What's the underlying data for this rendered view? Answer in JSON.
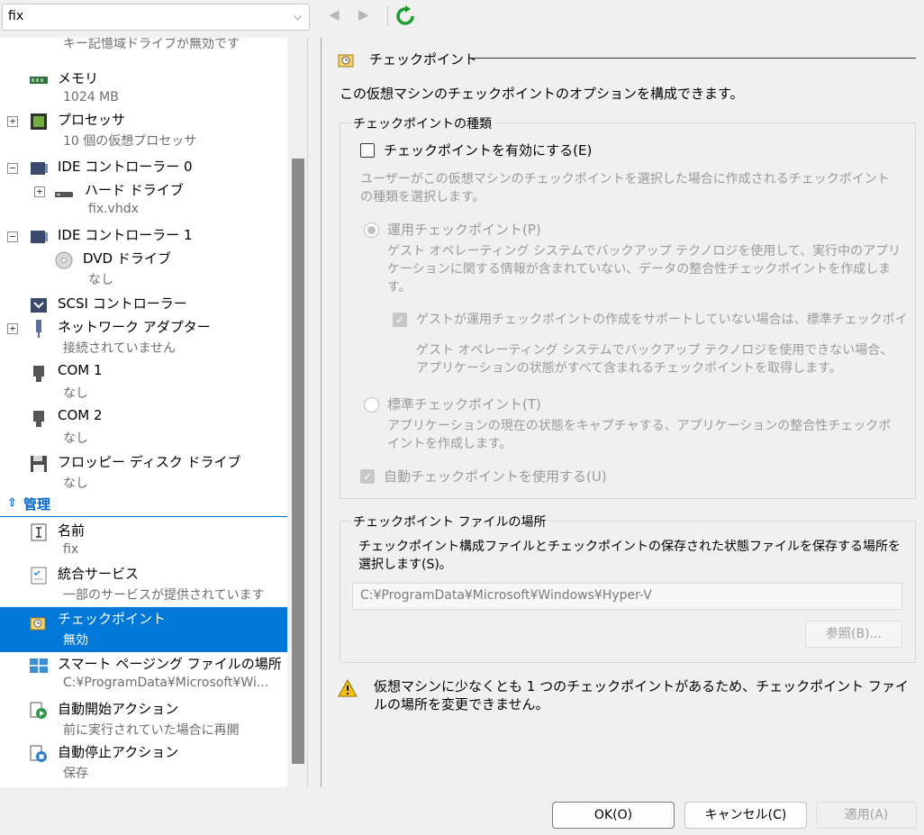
{
  "toolbar": {
    "vm_name": "fix",
    "back_icon": "◀",
    "forward_icon": "▶",
    "refresh_icon": "refresh-icon"
  },
  "tree": {
    "top_partial_sub": "キー記憶域ドライブが無効です",
    "items": [
      {
        "label": "メモリ",
        "sub": "1024 MB"
      },
      {
        "label": "プロセッサ",
        "sub": "10 個の仮想プロセッサ"
      },
      {
        "label": "IDE コントローラー 0",
        "sub": ""
      },
      {
        "label": "ハード ドライブ",
        "sub": "fix.vhdx"
      },
      {
        "label": "IDE コントローラー 1",
        "sub": ""
      },
      {
        "label": "DVD ドライブ",
        "sub": "なし"
      },
      {
        "label": "SCSI コントローラー",
        "sub": ""
      },
      {
        "label": "ネットワーク アダプター",
        "sub": "接続されていません"
      },
      {
        "label": "COM 1",
        "sub": "なし"
      },
      {
        "label": "COM 2",
        "sub": "なし"
      },
      {
        "label": "フロッピー ディスク ドライブ",
        "sub": "なし"
      }
    ],
    "management_header": "管理",
    "mgmt_items": [
      {
        "label": "名前",
        "sub": "fix"
      },
      {
        "label": "統合サービス",
        "sub": "一部のサービスが提供されています"
      },
      {
        "label": "チェックポイント",
        "sub": "無効"
      },
      {
        "label": "スマート ページング ファイルの場所",
        "sub": "C:¥ProgramData¥Microsoft¥Wi..."
      },
      {
        "label": "自動開始アクション",
        "sub": "前に実行されていた場合に再開"
      },
      {
        "label": "自動停止アクション",
        "sub": "保存"
      }
    ]
  },
  "panel": {
    "title": "チェックポイント",
    "description": "この仮想マシンのチェックポイントのオプションを構成できます。",
    "type_group": {
      "title": "チェックポイントの種類",
      "enable_label": "チェックポイントを有効にする(E)",
      "intro": "ユーザーがこの仮想マシンのチェックポイントを選択した場合に作成されるチェックポイントの種類を選択します。",
      "production_label": "運用チェックポイント(P)",
      "production_desc": "ゲスト オペレーティング システムでバックアップ テクノロジを使用して、実行中のアプリケーションに関する情報が含まれていない、データの整合性チェックポイントを作成します。",
      "fallback_label": "ゲストが運用チェックポイントの作成をサポートしていない場合は、標準チェックポイ",
      "fallback_desc": "ゲスト オペレーティング システムでバックアップ テクノロジを使用できない場合、アプリケーションの状態がすべて含まれるチェックポイントを取得します。",
      "standard_label": "標準チェックポイント(T)",
      "standard_desc": "アプリケーションの現在の状態をキャプチャする、アプリケーションの整合性チェックポイントを作成します。",
      "auto_label": "自動チェックポイントを使用する(U)"
    },
    "location_group": {
      "title": "チェックポイント ファイルの場所",
      "desc": "チェックポイント構成ファイルとチェックポイントの保存された状態ファイルを保存する場所を選択します(S)。",
      "path": "C:¥ProgramData¥Microsoft¥Windows¥Hyper-V",
      "browse_label": "参照(B)..."
    },
    "warning": "仮想マシンに少なくとも 1 つのチェックポイントがあるため、チェックポイント ファイルの場所を変更できません。"
  },
  "buttons": {
    "ok": "OK(O)",
    "cancel": "キャンセル(C)",
    "apply": "適用(A)"
  }
}
